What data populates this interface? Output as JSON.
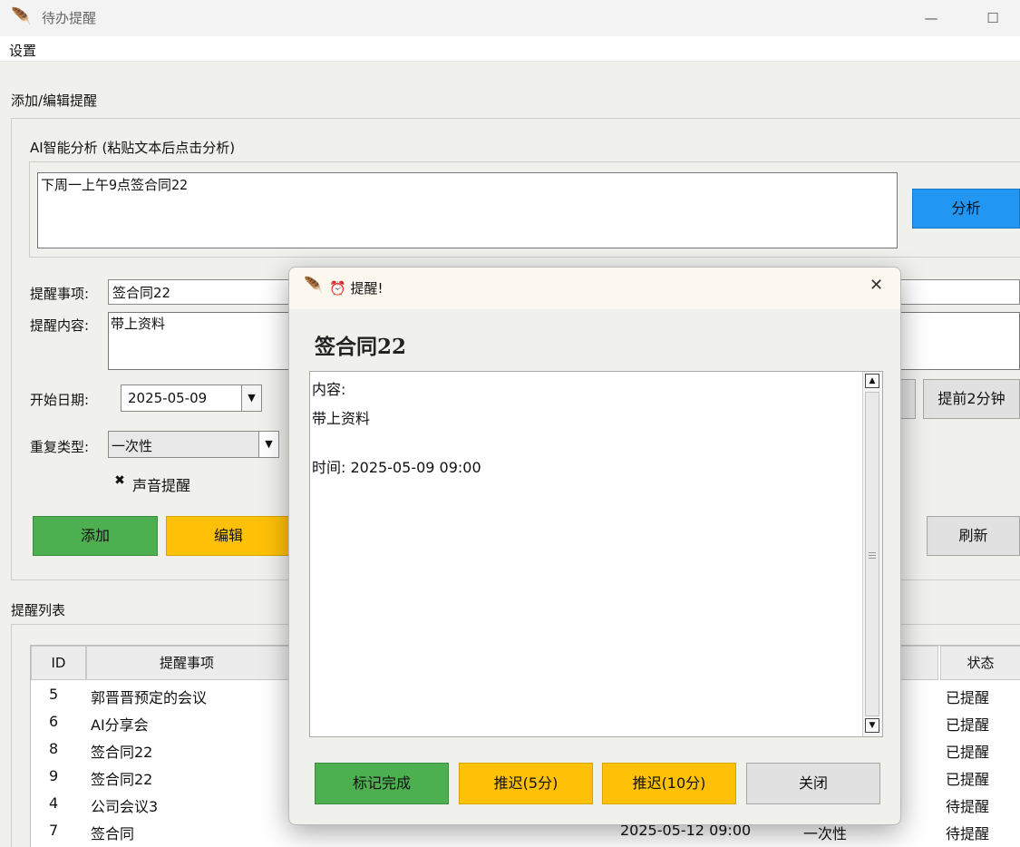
{
  "window": {
    "title": "待办提醒",
    "icon": "feather-icon",
    "controls": {
      "minimize": "—",
      "maximize": "☐"
    }
  },
  "menu": {
    "settings": "设置"
  },
  "form": {
    "section_title": "添加/编辑提醒",
    "ai": {
      "label": "AI智能分析 (粘贴文本后点击分析)",
      "text": "下周一上午9点签合同22",
      "analyze_button": "分析"
    },
    "fields": {
      "title_label": "提醒事项:",
      "title_value": "签合同22",
      "content_label": "提醒内容:",
      "content_value": "带上资料",
      "start_date_label": "开始日期:",
      "start_date_value": "2025-05-09",
      "repeat_label": "重复类型:",
      "repeat_value": "一次性",
      "sound_check": "✖",
      "sound_label": "声音提醒",
      "advance_button": "提前2分钟"
    },
    "buttons": {
      "add": "添加",
      "edit": "编辑",
      "refresh": "刷新"
    }
  },
  "list": {
    "section_title": "提醒列表",
    "columns": {
      "id": "ID",
      "title": "提醒事项",
      "status": "状态"
    },
    "rows": [
      {
        "id": "5",
        "title": "郭晋晋预定的会议",
        "time": "",
        "repeat": "",
        "status": "已提醒"
      },
      {
        "id": "6",
        "title": "AI分享会",
        "time": "",
        "repeat": "",
        "status": "已提醒"
      },
      {
        "id": "8",
        "title": "签合同22",
        "time": "",
        "repeat": "",
        "status": "已提醒"
      },
      {
        "id": "9",
        "title": "签合同22",
        "time": "",
        "repeat": "",
        "status": "已提醒"
      },
      {
        "id": "4",
        "title": "公司会议3",
        "time": "",
        "repeat": "",
        "status": "待提醒"
      },
      {
        "id": "7",
        "title": "签合同",
        "time": "2025-05-12 09:00",
        "repeat": "一次性",
        "status": "待提醒"
      }
    ]
  },
  "dialog": {
    "title": "⏰ 提醒!",
    "close": "✕",
    "heading": "签合同22",
    "body": {
      "content_label": "内容:",
      "content_value": "带上资料",
      "time_line": "时间: 2025-05-09 09:00"
    },
    "buttons": {
      "done": "标记完成",
      "snooze5": "推迟(5分)",
      "snooze10": "推迟(10分)",
      "close": "关闭"
    }
  },
  "colors": {
    "green": "#4caf50",
    "yellow": "#ffc107",
    "blue": "#2196f3",
    "gray": "#e1e1e1"
  }
}
